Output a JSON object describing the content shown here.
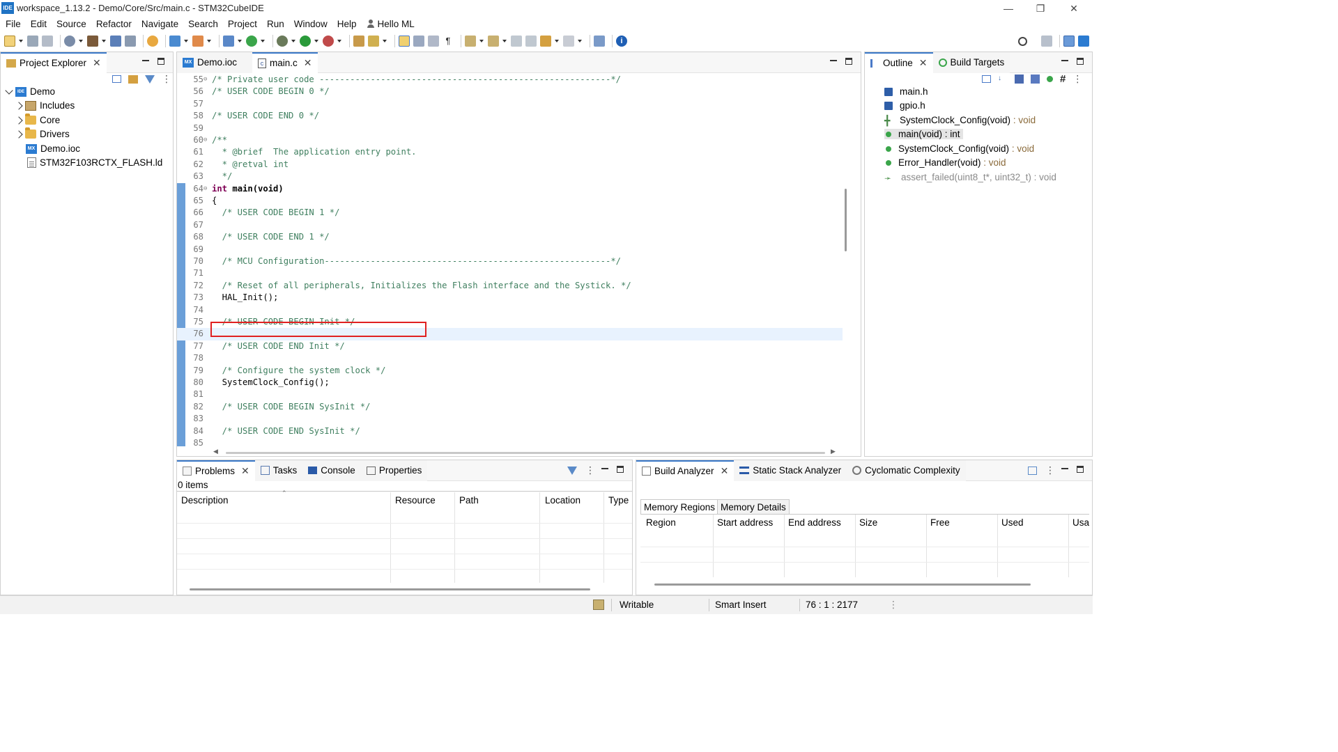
{
  "window": {
    "title": "workspace_1.13.2 - Demo/Core/Src/main.c - STM32CubeIDE",
    "app_badge": "IDE"
  },
  "menu": [
    "File",
    "Edit",
    "Source",
    "Refactor",
    "Navigate",
    "Search",
    "Project",
    "Run",
    "Window",
    "Help",
    "Hello ML"
  ],
  "project_explorer": {
    "tab_label": "Project Explorer",
    "tree": [
      {
        "label": "Demo",
        "icon": "ide-project-icon",
        "depth": 0,
        "expanded": true
      },
      {
        "label": "Includes",
        "icon": "includes-icon",
        "depth": 1,
        "expanded": false
      },
      {
        "label": "Core",
        "icon": "folder-icon",
        "depth": 1,
        "expanded": false
      },
      {
        "label": "Drivers",
        "icon": "folder-icon",
        "depth": 1,
        "expanded": false
      },
      {
        "label": "Demo.ioc",
        "icon": "mx-file-icon",
        "depth": 1
      },
      {
        "label": "STM32F103RCTX_FLASH.ld",
        "icon": "file-icon",
        "depth": 1
      }
    ]
  },
  "editor": {
    "tabs": [
      {
        "label": "Demo.ioc",
        "icon": "mx-file-icon",
        "active": false
      },
      {
        "label": "main.c",
        "icon": "c-file-icon",
        "active": true
      }
    ],
    "current_line": 76,
    "lines": [
      {
        "n": "55",
        "fold": "⊖",
        "text": "/* Private user code ---------------------------------------------------------*/",
        "kind": "cm"
      },
      {
        "n": "56",
        "text": "/* USER CODE BEGIN 0 */",
        "kind": "cm"
      },
      {
        "n": "57",
        "text": "",
        "kind": "pl"
      },
      {
        "n": "58",
        "text": "/* USER CODE END 0 */",
        "kind": "cm"
      },
      {
        "n": "59",
        "text": "",
        "kind": "pl"
      },
      {
        "n": "60",
        "fold": "⊖",
        "text": "/**",
        "kind": "cm"
      },
      {
        "n": "61",
        "text": "  * @brief  The application entry point.",
        "kind": "cm"
      },
      {
        "n": "62",
        "text": "  * @retval int",
        "kind": "cm"
      },
      {
        "n": "63",
        "text": "  */",
        "kind": "cm"
      },
      {
        "n": "64",
        "fold": "⊖",
        "text": "int main(void)",
        "kind": "sig"
      },
      {
        "n": "65",
        "text": "{",
        "kind": "pl"
      },
      {
        "n": "66",
        "text": "  /* USER CODE BEGIN 1 */",
        "kind": "cm"
      },
      {
        "n": "67",
        "text": "",
        "kind": "pl"
      },
      {
        "n": "68",
        "text": "  /* USER CODE END 1 */",
        "kind": "cm"
      },
      {
        "n": "69",
        "text": "",
        "kind": "pl"
      },
      {
        "n": "70",
        "text": "  /* MCU Configuration--------------------------------------------------------*/",
        "kind": "cm"
      },
      {
        "n": "71",
        "text": "",
        "kind": "pl"
      },
      {
        "n": "72",
        "text": "  /* Reset of all peripherals, Initializes the Flash interface and the Systick. */",
        "kind": "cm"
      },
      {
        "n": "73",
        "text": "  HAL_Init();",
        "kind": "pl"
      },
      {
        "n": "74",
        "text": "",
        "kind": "pl"
      },
      {
        "n": "75",
        "text": "  /* USER CODE BEGIN Init */",
        "kind": "cm"
      },
      {
        "n": "76",
        "text": "",
        "kind": "pl"
      },
      {
        "n": "77",
        "text": "  /* USER CODE END Init */",
        "kind": "cm"
      },
      {
        "n": "78",
        "text": "",
        "kind": "pl"
      },
      {
        "n": "79",
        "text": "  /* Configure the system clock */",
        "kind": "cm"
      },
      {
        "n": "80",
        "text": "  SystemClock_Config();",
        "kind": "pl"
      },
      {
        "n": "81",
        "text": "",
        "kind": "pl"
      },
      {
        "n": "82",
        "text": "  /* USER CODE BEGIN SysInit */",
        "kind": "cm"
      },
      {
        "n": "83",
        "text": "",
        "kind": "pl"
      },
      {
        "n": "84",
        "text": "  /* USER CODE END SysInit */",
        "kind": "cm"
      },
      {
        "n": "85",
        "text": "",
        "kind": "pl"
      }
    ]
  },
  "outline": {
    "tabs": [
      "Outline",
      "Build Targets"
    ],
    "items": [
      {
        "name": "main.h",
        "type": "",
        "icon": "header-include-icon"
      },
      {
        "name": "gpio.h",
        "type": "",
        "icon": "header-include-icon"
      },
      {
        "name": "SystemClock_Config(void)",
        "type": " : void",
        "icon": "function-declaration-icon"
      },
      {
        "name": "main(void) : int",
        "type": "",
        "icon": "function-icon",
        "selected": true
      },
      {
        "name": "SystemClock_Config(void)",
        "type": " : void",
        "icon": "function-icon"
      },
      {
        "name": "Error_Handler(void)",
        "type": " : void",
        "icon": "function-icon"
      },
      {
        "name": "assert_failed(uint8_t*, uint32_t)",
        "type": " : void",
        "icon": "inactive-function-icon",
        "dim": true
      }
    ]
  },
  "problems": {
    "tabs": [
      "Problems",
      "Tasks",
      "Console",
      "Properties"
    ],
    "count": "0 items",
    "columns": [
      "Description",
      "Resource",
      "Path",
      "Location",
      "Type"
    ]
  },
  "build_analyzer": {
    "tabs": [
      "Build Analyzer",
      "Static Stack Analyzer",
      "Cyclomatic Complexity"
    ],
    "subtabs": [
      "Memory Regions",
      "Memory Details"
    ],
    "columns": [
      "Region",
      "Start address",
      "End address",
      "Size",
      "Free",
      "Used",
      "Usa"
    ]
  },
  "status": {
    "mode": "Writable",
    "insert": "Smart Insert",
    "position": "76 : 1 : 2177"
  },
  "colors": {
    "accent": "#3a78c8",
    "comment": "#3f7f5f",
    "keyword": "#7f0055",
    "highlight_box": "#e02020",
    "current_line": "#e8f2fe"
  }
}
